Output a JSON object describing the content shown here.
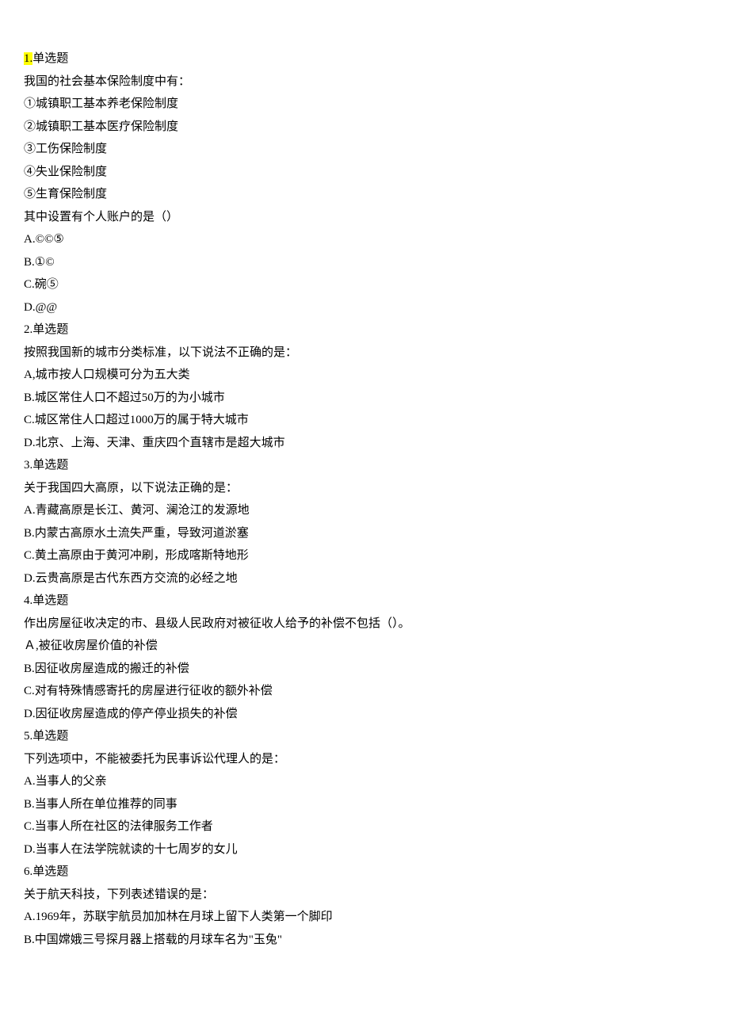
{
  "questions": [
    {
      "number": "1.",
      "type": "单选题",
      "highlight": true,
      "stem_lines": [
        "我国的社会基本保险制度中有：",
        "①城镇职工基本养老保险制度",
        "②城镇职工基本医疗保险制度",
        "③工伤保险制度",
        "④失业保险制度",
        "⑤生育保险制度",
        "其中设置有个人账户的是（）"
      ],
      "options": [
        "A.©©⑤",
        "B.①©",
        "C.碗⑤",
        "D.@@"
      ]
    },
    {
      "number": "2.",
      "type": "单选题",
      "highlight": false,
      "stem_lines": [
        "按照我国新的城市分类标准，以下说法不正确的是："
      ],
      "options": [
        "A,城市按人口规模可分为五大类",
        "B.城区常住人口不超过50万的为小城市",
        "C.城区常住人口超过1000万的属于特大城市",
        "D.北京、上海、天津、重庆四个直辖市是超大城市"
      ]
    },
    {
      "number": "3.",
      "type": "单选题",
      "highlight": false,
      "stem_lines": [
        "关于我国四大高原，以下说法正确的是："
      ],
      "options": [
        "A.青藏高原是长江、黄河、澜沧江的发源地",
        "B.内蒙古高原水土流失严重，导致河道淤塞",
        "C.黄土高原由于黄河冲刷，形成喀斯特地形",
        "D.云贵高原是古代东西方交流的必经之地"
      ]
    },
    {
      "number": "4.",
      "type": "单选题",
      "highlight": false,
      "stem_lines": [
        "作出房屋征收决定的市、县级人民政府对被征收人给予的补偿不包括（）。"
      ],
      "options": [
        "Ａ,被征收房屋价值的补偿",
        "B.因征收房屋造成的搬迁的补偿",
        "C.对有特殊情感寄托的房屋进行征收的额外补偿",
        "D.因征收房屋造成的停产停业损失的补偿"
      ]
    },
    {
      "number": "5.",
      "type": "单选题",
      "highlight": false,
      "stem_lines": [
        "下列选项中，不能被委托为民事诉讼代理人的是："
      ],
      "options": [
        "A.当事人的父亲",
        "B.当事人所在单位推荐的同事",
        "C.当事人所在社区的法律服务工作者",
        "D.当事人在法学院就读的十七周岁的女儿"
      ]
    },
    {
      "number": "6.",
      "type": "单选题",
      "highlight": false,
      "stem_lines": [
        "关于航天科技，下列表述错误的是："
      ],
      "options": [
        "A.1969年，苏联宇航员加加林在月球上留下人类第一个脚印",
        "B.中国嫦娥三号探月器上搭载的月球车名为\"玉兔\""
      ]
    }
  ]
}
